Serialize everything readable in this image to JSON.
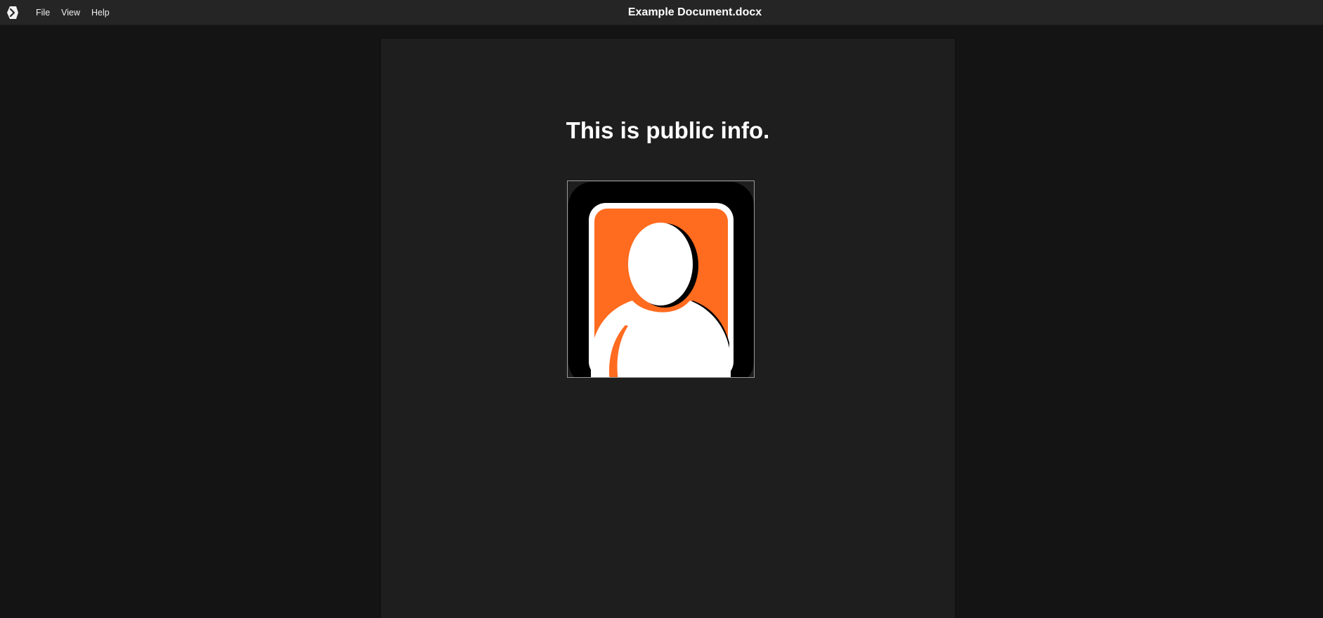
{
  "window": {
    "title": "Example Document.docx"
  },
  "menu": {
    "items": [
      {
        "label": "File"
      },
      {
        "label": "View"
      },
      {
        "label": "Help"
      }
    ]
  },
  "document": {
    "heading": "This is public info.",
    "image": {
      "icon": "user-avatar-icon",
      "colors": {
        "background": "#000000",
        "frame": "#ffffff",
        "accent": "#ff6b1f",
        "figure": "#ffffff"
      }
    }
  },
  "theme": {
    "titlebar": "#252525",
    "viewer_background": "#141414",
    "page_background": "#1e1e1e",
    "text": "#ffffff"
  }
}
